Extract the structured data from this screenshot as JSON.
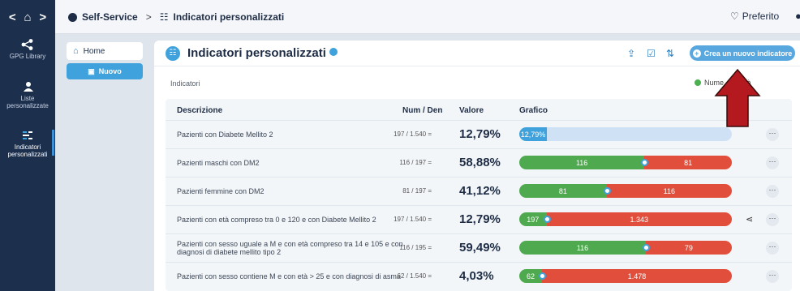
{
  "topbar": {
    "back_label": "<",
    "home_label": "⌂",
    "forward_label": ">",
    "breadcrumb": [
      "Self-Service",
      "Indicatori personalizzati"
    ],
    "separator": ">",
    "favorite_label": "Preferito",
    "favorite_icon": "♡",
    "user_icon": "person-icon"
  },
  "sidebar": {
    "items": [
      {
        "label": "GPG Library",
        "icon": "share-icon"
      },
      {
        "label": "Liste personalizzate",
        "icon": "list-people-icon"
      },
      {
        "label": "Indicatori personalizzati",
        "icon": "indicators-icon"
      }
    ]
  },
  "subnav": {
    "home_label": "Home",
    "new_label": "Nuovo"
  },
  "panel": {
    "title": "Indicatori personalizzati",
    "subtitle": "Indicatori",
    "create_button": "Crea un nuovo indicatore",
    "legend_numerator": "Nume",
    "legend_criticality": "riticità",
    "accent": "#3fa2dc"
  },
  "table": {
    "columns": [
      "Descrizione",
      "Num / Den",
      "Valore",
      "Grafico"
    ],
    "rows": [
      {
        "desc": "Pazienti con Diabete Mellito 2",
        "numden": "197 / 1.540 =",
        "valore": "12,79%",
        "bar_type": "percent",
        "bar_label": "12,79%",
        "share": 0.1279
      },
      {
        "desc": "Pazienti maschi con DM2",
        "numden": "116 / 197 =",
        "valore": "58,88%",
        "bar_type": "split",
        "left": "116",
        "right": "81",
        "share": 0.5888
      },
      {
        "desc": "Pazienti femmine con DM2",
        "numden": "81 / 197 =",
        "valore": "41,12%",
        "bar_type": "split",
        "left": "81",
        "right": "116",
        "share": 0.4112
      },
      {
        "desc": "Pazienti con età compreso tra 0 e 120 e con Diabete Mellito 2",
        "numden": "197 / 1.540 =",
        "valore": "12,79%",
        "bar_type": "split",
        "left": "197",
        "right": "1.343",
        "share": 0.1279,
        "shared": true
      },
      {
        "desc": "Pazienti con sesso uguale a M e con età compreso tra 14 e 105 e con diagnosi di diabete mellito tipo 2",
        "numden": "116 / 195 =",
        "valore": "59,49%",
        "bar_type": "split",
        "left": "116",
        "right": "79",
        "share": 0.5949
      },
      {
        "desc": "Pazienti con sesso contiene M e con età > 25 e con diagnosi di asma",
        "numden": "62 / 1.540 =",
        "valore": "4,03%",
        "bar_type": "split",
        "left": "62",
        "right": "1.478",
        "share": 0.0403
      }
    ]
  }
}
